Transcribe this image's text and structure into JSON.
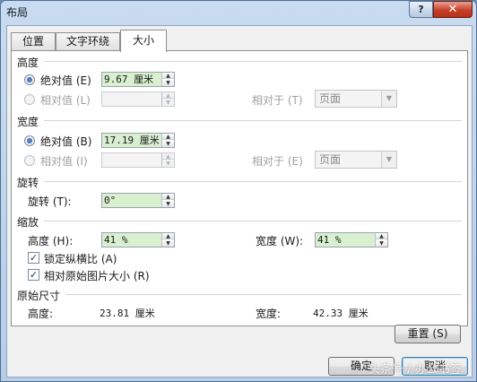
{
  "window": {
    "title": "布局",
    "help_glyph": "?",
    "close_glyph": "✕"
  },
  "tabs": [
    {
      "label": "位置"
    },
    {
      "label": "文字环绕"
    },
    {
      "label": "大小"
    }
  ],
  "height_section": {
    "title": "高度",
    "absolute_label": "绝对值 (E)",
    "absolute_value": "9.67 厘米",
    "relative_label": "相对值 (L)",
    "relative_value": "",
    "relative_to_label": "相对于 (T)",
    "relative_to_value": "页面"
  },
  "width_section": {
    "title": "宽度",
    "absolute_label": "绝对值 (B)",
    "absolute_value": "17.19 厘米",
    "relative_label": "相对值 (I)",
    "relative_value": "",
    "relative_to_label": "相对于 (E)",
    "relative_to_value": "页面"
  },
  "rotate_section": {
    "title": "旋转",
    "rotate_label": "旋转 (T):",
    "rotate_value": "0°"
  },
  "scale_section": {
    "title": "缩放",
    "height_label": "高度 (H):",
    "height_value": "41 %",
    "width_label": "宽度 (W):",
    "width_value": "41 %",
    "lock_aspect_label": "锁定纵横比 (A)",
    "lock_aspect_checked": true,
    "relative_original_label": "相对原始图片大小 (R)",
    "relative_original_checked": true
  },
  "original_section": {
    "title": "原始尺寸",
    "height_label": "高度:",
    "height_value": "23.81 厘米",
    "width_label": "宽度:",
    "width_value": "42.33 厘米"
  },
  "buttons": {
    "reset": "重置 (S)",
    "ok": "确定",
    "cancel": "取消"
  },
  "watermark": "头条号 / 办公书签",
  "colors": {
    "title_bar": "#b7cde6",
    "close_button": "#c5402a",
    "green_field": "#d8f0d0"
  }
}
